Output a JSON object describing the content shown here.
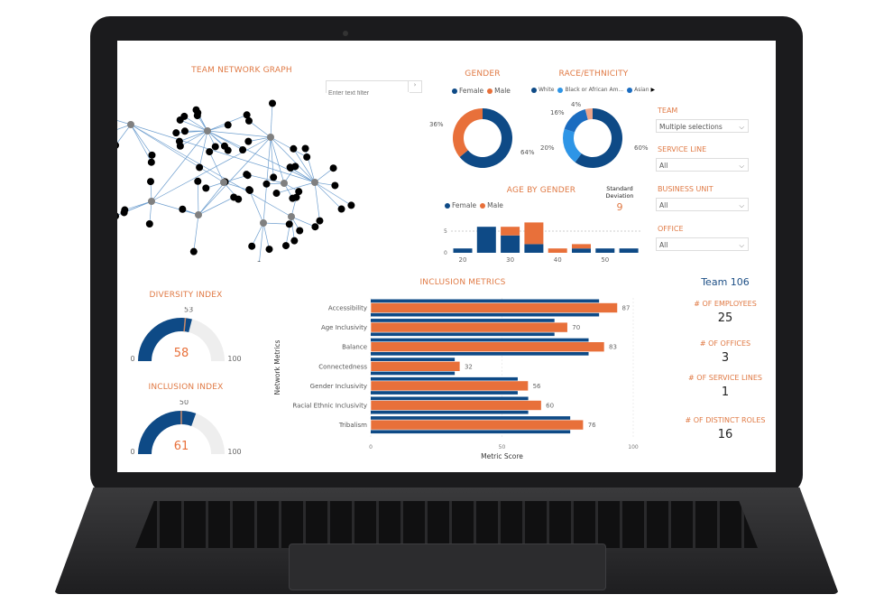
{
  "colors": {
    "navy": "#0e4a86",
    "orange": "#e8703a",
    "light_blue": "#2e95e6",
    "mid_blue": "#1b6cc0",
    "peach": "#eca58a",
    "title": "#e07a45",
    "gauge_bg": "#eeeeee"
  },
  "network": {
    "title": "TEAM NETWORK GRAPH",
    "filter_placeholder": "Enter text filter",
    "filter_button": "›"
  },
  "gender": {
    "title": "GENDER",
    "legend": [
      "Female",
      "Male"
    ],
    "slices": [
      {
        "name": "Female",
        "value": 64,
        "label": "64%"
      },
      {
        "name": "Male",
        "value": 36,
        "label": "36%"
      }
    ]
  },
  "race": {
    "title": "RACE/ETHNICITY",
    "legend": [
      "White",
      "Black or African Am...",
      "Asian"
    ],
    "slices": [
      {
        "name": "White",
        "value": 60,
        "label": "60%"
      },
      {
        "name": "Black or African American",
        "value": 20,
        "label": "20%"
      },
      {
        "name": "Asian",
        "value": 16,
        "label": "16%"
      },
      {
        "name": "Other",
        "value": 4,
        "label": "4%"
      }
    ]
  },
  "filters": [
    {
      "label": "TEAM",
      "value": "Multiple selections"
    },
    {
      "label": "SERVICE LINE",
      "value": "All"
    },
    {
      "label": "BUSINESS UNIT",
      "value": "All"
    },
    {
      "label": "OFFICE",
      "value": "All"
    }
  ],
  "age": {
    "title": "AGE BY GENDER",
    "legend": [
      "Female",
      "Male"
    ],
    "std_label_1": "Standard",
    "std_label_2": "Deviation",
    "std_value": "9"
  },
  "diversity": {
    "title": "DIVERSITY INDEX",
    "value": 58,
    "target": 53,
    "min": "0",
    "max": "100",
    "value_text": "58",
    "target_text": "53"
  },
  "inclusion_index": {
    "title": "INCLUSION INDEX",
    "value": 61,
    "target": 50,
    "min": "0",
    "max": "100",
    "value_text": "61",
    "target_text": "50"
  },
  "kpis": {
    "team": "Team 106",
    "items": [
      {
        "label": "# OF EMPLOYEES",
        "value": "25"
      },
      {
        "label": "# OF OFFICES",
        "value": "3"
      },
      {
        "label": "# OF SERVICE LINES",
        "value": "1"
      },
      {
        "label": "# OF DISTINCT ROLES",
        "value": "16"
      }
    ]
  },
  "chart_data": [
    {
      "type": "bar",
      "title": "AGE BY GENDER",
      "x": [
        20,
        25,
        30,
        35,
        40,
        45,
        50,
        55
      ],
      "xticks": [
        "20",
        "30",
        "40",
        "50"
      ],
      "yticks": [
        "0",
        "5"
      ],
      "stacked": true,
      "series": [
        {
          "name": "Female",
          "values": [
            1,
            6,
            4,
            2,
            0,
            1,
            1,
            1
          ]
        },
        {
          "name": "Male",
          "values": [
            0,
            0,
            2,
            5,
            1,
            1,
            0,
            0
          ]
        }
      ],
      "ylim": [
        0,
        7
      ]
    },
    {
      "type": "bar",
      "orientation": "horizontal",
      "title": "INCLUSION METRICS",
      "xlabel": "Metric Score",
      "ylabel": "Network Metrics",
      "xlim": [
        0,
        100
      ],
      "xticks": [
        "0",
        "50",
        "100"
      ],
      "categories": [
        "Accessibility",
        "Age Inclusivity",
        "Balance",
        "Connectedness",
        "Gender Inclusivity",
        "Racial Ethnic Inclusivity",
        "Tribalism"
      ],
      "series": [
        {
          "values": [
            87,
            70,
            83,
            32,
            56,
            60,
            76
          ]
        },
        {
          "values": [
            94,
            75,
            89,
            34,
            60,
            65,
            81
          ]
        }
      ],
      "data_labels": [
        "87",
        "70",
        "83",
        "32",
        "56",
        "60",
        "76"
      ]
    }
  ]
}
